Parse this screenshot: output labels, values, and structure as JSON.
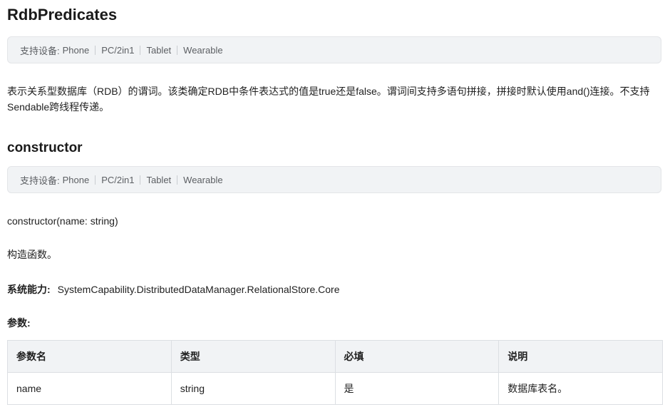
{
  "title": "RdbPredicates",
  "devices_label": "支持设备:",
  "devices": [
    "Phone",
    "PC/2in1",
    "Tablet",
    "Wearable"
  ],
  "description": "表示关系型数据库（RDB）的谓词。该类确定RDB中条件表达式的值是true还是false。谓词间支持多语句拼接，拼接时默认使用and()连接。不支持Sendable跨线程传递。",
  "constructor": {
    "heading": "constructor",
    "signature": "constructor(name: string)",
    "summary": "构造函数。",
    "syscap_label": "系统能力:",
    "syscap_value": "SystemCapability.DistributedDataManager.RelationalStore.Core",
    "params_label": "参数:",
    "params_table": {
      "headers": [
        "参数名",
        "类型",
        "必填",
        "说明"
      ],
      "rows": [
        [
          "name",
          "string",
          "是",
          "数据库表名。"
        ]
      ]
    }
  }
}
